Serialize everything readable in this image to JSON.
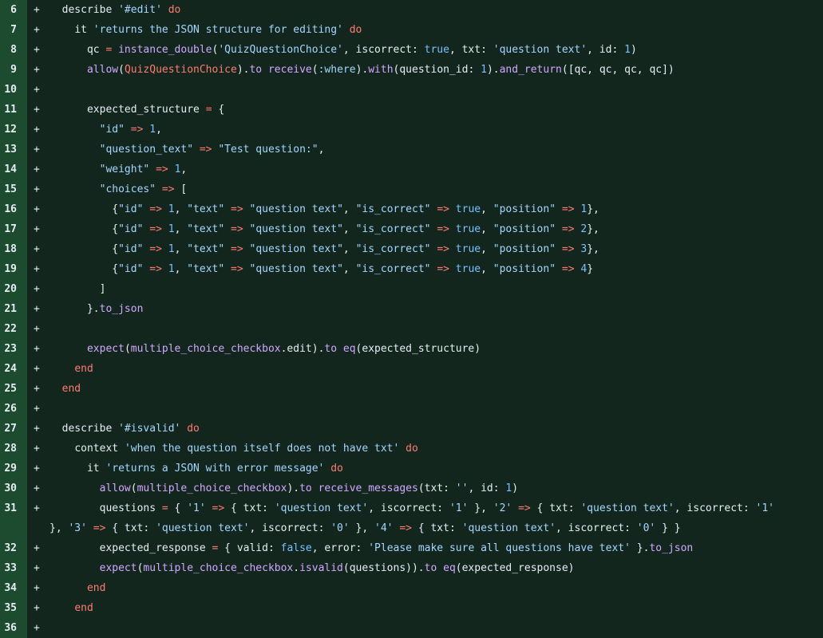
{
  "diff": {
    "marker": "+",
    "lines": [
      {
        "n": 6,
        "tokens": [
          [
            "pl",
            "  "
          ],
          [
            "pl",
            "describe "
          ],
          [
            "st",
            "'#edit'"
          ],
          [
            "pl",
            " "
          ],
          [
            "kw",
            "do"
          ]
        ]
      },
      {
        "n": 7,
        "tokens": [
          [
            "pl",
            "    "
          ],
          [
            "pl",
            "it "
          ],
          [
            "st",
            "'returns the JSON structure for editing'"
          ],
          [
            "pl",
            " "
          ],
          [
            "kw",
            "do"
          ]
        ]
      },
      {
        "n": 8,
        "tokens": [
          [
            "pl",
            "      qc "
          ],
          [
            "kw",
            "="
          ],
          [
            "pl",
            " "
          ],
          [
            "fn",
            "instance_double"
          ],
          [
            "pl",
            "("
          ],
          [
            "st",
            "'QuizQuestionChoice'"
          ],
          [
            "pl",
            ", iscorrect: "
          ],
          [
            "nm",
            "true"
          ],
          [
            "pl",
            ", txt: "
          ],
          [
            "st",
            "'question text'"
          ],
          [
            "pl",
            ", id: "
          ],
          [
            "nm",
            "1"
          ],
          [
            "pl",
            ")"
          ]
        ]
      },
      {
        "n": 9,
        "tokens": [
          [
            "pl",
            "      "
          ],
          [
            "fn",
            "allow"
          ],
          [
            "pl",
            "("
          ],
          [
            "kw",
            "QuizQuestionChoice"
          ],
          [
            "pl",
            ")."
          ],
          [
            "fn",
            "to"
          ],
          [
            "pl",
            " "
          ],
          [
            "fn",
            "receive"
          ],
          [
            "pl",
            "("
          ],
          [
            "st",
            ":where"
          ],
          [
            "pl",
            ")."
          ],
          [
            "fn",
            "with"
          ],
          [
            "pl",
            "(question_id: "
          ],
          [
            "nm",
            "1"
          ],
          [
            "pl",
            ")."
          ],
          [
            "fn",
            "and_return"
          ],
          [
            "pl",
            "([qc, qc, qc, qc])"
          ]
        ]
      },
      {
        "n": 10,
        "tokens": []
      },
      {
        "n": 11,
        "tokens": [
          [
            "pl",
            "      expected_structure "
          ],
          [
            "kw",
            "="
          ],
          [
            "pl",
            " {"
          ]
        ]
      },
      {
        "n": 12,
        "tokens": [
          [
            "pl",
            "        "
          ],
          [
            "st",
            "\"id\""
          ],
          [
            "pl",
            " "
          ],
          [
            "kw",
            "=>"
          ],
          [
            "pl",
            " "
          ],
          [
            "nm",
            "1"
          ],
          [
            "pl",
            ","
          ]
        ]
      },
      {
        "n": 13,
        "tokens": [
          [
            "pl",
            "        "
          ],
          [
            "st",
            "\"question_text\""
          ],
          [
            "pl",
            " "
          ],
          [
            "kw",
            "=>"
          ],
          [
            "pl",
            " "
          ],
          [
            "st",
            "\"Test question:\""
          ],
          [
            "pl",
            ","
          ]
        ]
      },
      {
        "n": 14,
        "tokens": [
          [
            "pl",
            "        "
          ],
          [
            "st",
            "\"weight\""
          ],
          [
            "pl",
            " "
          ],
          [
            "kw",
            "=>"
          ],
          [
            "pl",
            " "
          ],
          [
            "nm",
            "1"
          ],
          [
            "pl",
            ","
          ]
        ]
      },
      {
        "n": 15,
        "tokens": [
          [
            "pl",
            "        "
          ],
          [
            "st",
            "\"choices\""
          ],
          [
            "pl",
            " "
          ],
          [
            "kw",
            "=>"
          ],
          [
            "pl",
            " ["
          ]
        ]
      },
      {
        "n": 16,
        "tokens": [
          [
            "pl",
            "          {"
          ],
          [
            "st",
            "\"id\""
          ],
          [
            "pl",
            " "
          ],
          [
            "kw",
            "=>"
          ],
          [
            "pl",
            " "
          ],
          [
            "nm",
            "1"
          ],
          [
            "pl",
            ", "
          ],
          [
            "st",
            "\"text\""
          ],
          [
            "pl",
            " "
          ],
          [
            "kw",
            "=>"
          ],
          [
            "pl",
            " "
          ],
          [
            "st",
            "\"question text\""
          ],
          [
            "pl",
            ", "
          ],
          [
            "st",
            "\"is_correct\""
          ],
          [
            "pl",
            " "
          ],
          [
            "kw",
            "=>"
          ],
          [
            "pl",
            " "
          ],
          [
            "nm",
            "true"
          ],
          [
            "pl",
            ", "
          ],
          [
            "st",
            "\"position\""
          ],
          [
            "pl",
            " "
          ],
          [
            "kw",
            "=>"
          ],
          [
            "pl",
            " "
          ],
          [
            "nm",
            "1"
          ],
          [
            "pl",
            "},"
          ]
        ]
      },
      {
        "n": 17,
        "tokens": [
          [
            "pl",
            "          {"
          ],
          [
            "st",
            "\"id\""
          ],
          [
            "pl",
            " "
          ],
          [
            "kw",
            "=>"
          ],
          [
            "pl",
            " "
          ],
          [
            "nm",
            "1"
          ],
          [
            "pl",
            ", "
          ],
          [
            "st",
            "\"text\""
          ],
          [
            "pl",
            " "
          ],
          [
            "kw",
            "=>"
          ],
          [
            "pl",
            " "
          ],
          [
            "st",
            "\"question text\""
          ],
          [
            "pl",
            ", "
          ],
          [
            "st",
            "\"is_correct\""
          ],
          [
            "pl",
            " "
          ],
          [
            "kw",
            "=>"
          ],
          [
            "pl",
            " "
          ],
          [
            "nm",
            "true"
          ],
          [
            "pl",
            ", "
          ],
          [
            "st",
            "\"position\""
          ],
          [
            "pl",
            " "
          ],
          [
            "kw",
            "=>"
          ],
          [
            "pl",
            " "
          ],
          [
            "nm",
            "2"
          ],
          [
            "pl",
            "},"
          ]
        ]
      },
      {
        "n": 18,
        "tokens": [
          [
            "pl",
            "          {"
          ],
          [
            "st",
            "\"id\""
          ],
          [
            "pl",
            " "
          ],
          [
            "kw",
            "=>"
          ],
          [
            "pl",
            " "
          ],
          [
            "nm",
            "1"
          ],
          [
            "pl",
            ", "
          ],
          [
            "st",
            "\"text\""
          ],
          [
            "pl",
            " "
          ],
          [
            "kw",
            "=>"
          ],
          [
            "pl",
            " "
          ],
          [
            "st",
            "\"question text\""
          ],
          [
            "pl",
            ", "
          ],
          [
            "st",
            "\"is_correct\""
          ],
          [
            "pl",
            " "
          ],
          [
            "kw",
            "=>"
          ],
          [
            "pl",
            " "
          ],
          [
            "nm",
            "true"
          ],
          [
            "pl",
            ", "
          ],
          [
            "st",
            "\"position\""
          ],
          [
            "pl",
            " "
          ],
          [
            "kw",
            "=>"
          ],
          [
            "pl",
            " "
          ],
          [
            "nm",
            "3"
          ],
          [
            "pl",
            "},"
          ]
        ]
      },
      {
        "n": 19,
        "tokens": [
          [
            "pl",
            "          {"
          ],
          [
            "st",
            "\"id\""
          ],
          [
            "pl",
            " "
          ],
          [
            "kw",
            "=>"
          ],
          [
            "pl",
            " "
          ],
          [
            "nm",
            "1"
          ],
          [
            "pl",
            ", "
          ],
          [
            "st",
            "\"text\""
          ],
          [
            "pl",
            " "
          ],
          [
            "kw",
            "=>"
          ],
          [
            "pl",
            " "
          ],
          [
            "st",
            "\"question text\""
          ],
          [
            "pl",
            ", "
          ],
          [
            "st",
            "\"is_correct\""
          ],
          [
            "pl",
            " "
          ],
          [
            "kw",
            "=>"
          ],
          [
            "pl",
            " "
          ],
          [
            "nm",
            "true"
          ],
          [
            "pl",
            ", "
          ],
          [
            "st",
            "\"position\""
          ],
          [
            "pl",
            " "
          ],
          [
            "kw",
            "=>"
          ],
          [
            "pl",
            " "
          ],
          [
            "nm",
            "4"
          ],
          [
            "pl",
            "}"
          ]
        ]
      },
      {
        "n": 20,
        "tokens": [
          [
            "pl",
            "        ]"
          ]
        ]
      },
      {
        "n": 21,
        "tokens": [
          [
            "pl",
            "      }."
          ],
          [
            "fn",
            "to_json"
          ]
        ]
      },
      {
        "n": 22,
        "tokens": []
      },
      {
        "n": 23,
        "tokens": [
          [
            "pl",
            "      "
          ],
          [
            "fn",
            "expect"
          ],
          [
            "pl",
            "("
          ],
          [
            "fn",
            "multiple_choice_checkbox"
          ],
          [
            "pl",
            ".edit)."
          ],
          [
            "fn",
            "to"
          ],
          [
            "pl",
            " "
          ],
          [
            "fn",
            "eq"
          ],
          [
            "pl",
            "(expected_structure)"
          ]
        ]
      },
      {
        "n": 24,
        "tokens": [
          [
            "pl",
            "    "
          ],
          [
            "kw",
            "end"
          ]
        ]
      },
      {
        "n": 25,
        "tokens": [
          [
            "pl",
            "  "
          ],
          [
            "kw",
            "end"
          ]
        ]
      },
      {
        "n": 26,
        "tokens": []
      },
      {
        "n": 27,
        "tokens": [
          [
            "pl",
            "  describe "
          ],
          [
            "st",
            "'#isvalid'"
          ],
          [
            "pl",
            " "
          ],
          [
            "kw",
            "do"
          ]
        ]
      },
      {
        "n": 28,
        "tokens": [
          [
            "pl",
            "    context "
          ],
          [
            "st",
            "'when the question itself does not have txt'"
          ],
          [
            "pl",
            " "
          ],
          [
            "kw",
            "do"
          ]
        ]
      },
      {
        "n": 29,
        "tokens": [
          [
            "pl",
            "      it "
          ],
          [
            "st",
            "'returns a JSON with error message'"
          ],
          [
            "pl",
            " "
          ],
          [
            "kw",
            "do"
          ]
        ]
      },
      {
        "n": 30,
        "tokens": [
          [
            "pl",
            "        "
          ],
          [
            "fn",
            "allow"
          ],
          [
            "pl",
            "("
          ],
          [
            "fn",
            "multiple_choice_checkbox"
          ],
          [
            "pl",
            ")."
          ],
          [
            "fn",
            "to"
          ],
          [
            "pl",
            " "
          ],
          [
            "fn",
            "receive_messages"
          ],
          [
            "pl",
            "(txt: "
          ],
          [
            "st",
            "''"
          ],
          [
            "pl",
            ", id: "
          ],
          [
            "nm",
            "1"
          ],
          [
            "pl",
            ")"
          ]
        ]
      },
      {
        "n": 31,
        "wrap": true,
        "tokens": [
          [
            "pl",
            "        questions "
          ],
          [
            "kw",
            "="
          ],
          [
            "pl",
            " { "
          ],
          [
            "st",
            "'1'"
          ],
          [
            "pl",
            " "
          ],
          [
            "kw",
            "=>"
          ],
          [
            "pl",
            " { txt: "
          ],
          [
            "st",
            "'question text'"
          ],
          [
            "pl",
            ", iscorrect: "
          ],
          [
            "st",
            "'1'"
          ],
          [
            "pl",
            " }, "
          ],
          [
            "st",
            "'2'"
          ],
          [
            "pl",
            " "
          ],
          [
            "kw",
            "=>"
          ],
          [
            "pl",
            " { txt: "
          ],
          [
            "st",
            "'question text'"
          ],
          [
            "pl",
            ", iscorrect: "
          ],
          [
            "st",
            "'1'"
          ],
          [
            "pl",
            "\n}, "
          ],
          [
            "st",
            "'3'"
          ],
          [
            "pl",
            " "
          ],
          [
            "kw",
            "=>"
          ],
          [
            "pl",
            " { txt: "
          ],
          [
            "st",
            "'question text'"
          ],
          [
            "pl",
            ", iscorrect: "
          ],
          [
            "st",
            "'0'"
          ],
          [
            "pl",
            " }, "
          ],
          [
            "st",
            "'4'"
          ],
          [
            "pl",
            " "
          ],
          [
            "kw",
            "=>"
          ],
          [
            "pl",
            " { txt: "
          ],
          [
            "st",
            "'question text'"
          ],
          [
            "pl",
            ", iscorrect: "
          ],
          [
            "st",
            "'0'"
          ],
          [
            "pl",
            " } }"
          ]
        ]
      },
      {
        "n": 32,
        "tokens": [
          [
            "pl",
            "        expected_response "
          ],
          [
            "kw",
            "="
          ],
          [
            "pl",
            " { valid: "
          ],
          [
            "nm",
            "false"
          ],
          [
            "pl",
            ", error: "
          ],
          [
            "st",
            "'Please make sure all questions have text'"
          ],
          [
            "pl",
            " }."
          ],
          [
            "fn",
            "to_json"
          ]
        ]
      },
      {
        "n": 33,
        "tokens": [
          [
            "pl",
            "        "
          ],
          [
            "fn",
            "expect"
          ],
          [
            "pl",
            "("
          ],
          [
            "fn",
            "multiple_choice_checkbox"
          ],
          [
            "pl",
            "."
          ],
          [
            "fn",
            "isvalid"
          ],
          [
            "pl",
            "(questions))."
          ],
          [
            "fn",
            "to"
          ],
          [
            "pl",
            " "
          ],
          [
            "fn",
            "eq"
          ],
          [
            "pl",
            "(expected_response)"
          ]
        ]
      },
      {
        "n": 34,
        "tokens": [
          [
            "pl",
            "      "
          ],
          [
            "kw",
            "end"
          ]
        ]
      },
      {
        "n": 35,
        "tokens": [
          [
            "pl",
            "    "
          ],
          [
            "kw",
            "end"
          ]
        ]
      },
      {
        "n": 36,
        "tokens": []
      }
    ]
  },
  "colors": {
    "gutter_bg": "#1d4b2f",
    "code_bg": "#12261e",
    "keyword": "#ff7b72",
    "string": "#a5d6ff",
    "function": "#d2a8ff",
    "number": "#79c0ff",
    "plain": "#e6edf3"
  }
}
